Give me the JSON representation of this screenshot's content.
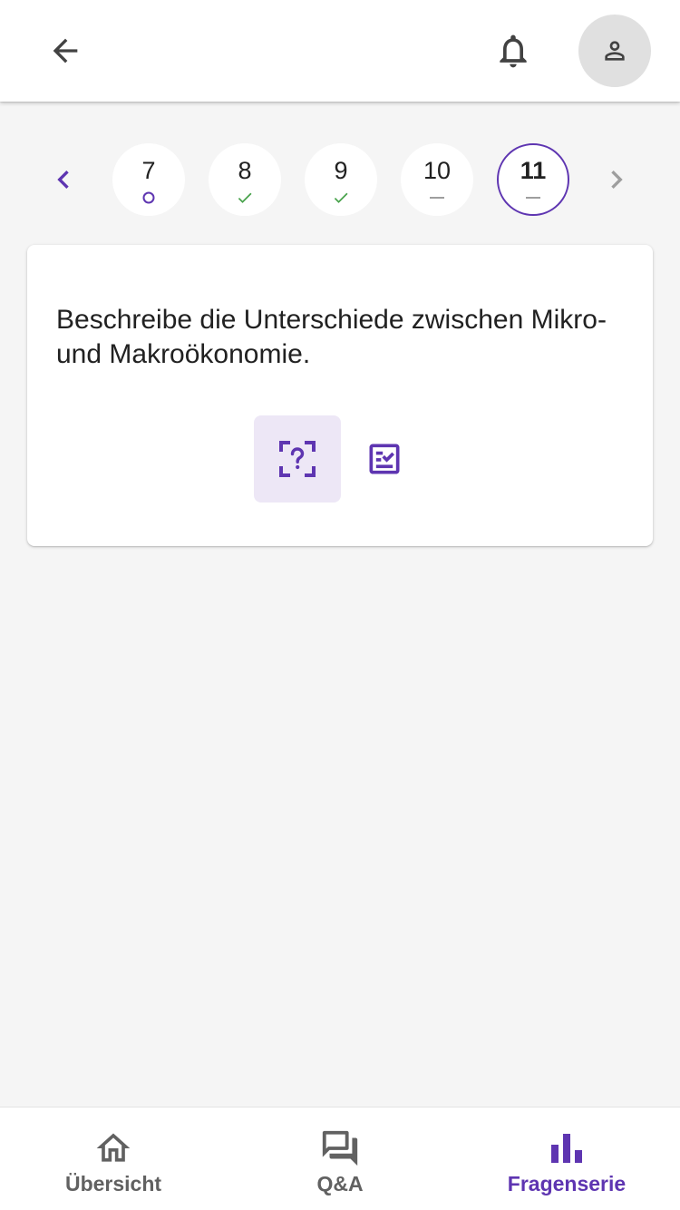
{
  "header": {
    "back_icon": "arrow-left-icon",
    "notification_icon": "bell-icon",
    "profile_icon": "person-icon"
  },
  "question_nav": {
    "prev_icon": "chevron-left-icon",
    "next_icon": "chevron-right-icon",
    "items": [
      {
        "number": "7",
        "status": "open",
        "status_icon": "circle-outline-icon"
      },
      {
        "number": "8",
        "status": "correct",
        "status_icon": "check-icon"
      },
      {
        "number": "9",
        "status": "correct",
        "status_icon": "check-icon"
      },
      {
        "number": "10",
        "status": "skipped",
        "status_icon": "dash-icon"
      },
      {
        "number": "11",
        "status": "skipped",
        "status_icon": "dash-icon",
        "active": true
      }
    ]
  },
  "card": {
    "question": "Beschreibe die Unterschiede zwischen Mi­kro- und Makroökonomie.",
    "modes": [
      {
        "icon": "question-frame-icon",
        "selected": true
      },
      {
        "icon": "checklist-icon",
        "selected": false
      }
    ]
  },
  "bottom_nav": {
    "items": [
      {
        "label": "Übersicht",
        "icon": "home-icon",
        "active": false
      },
      {
        "label": "Q&A",
        "icon": "forum-icon",
        "active": false
      },
      {
        "label": "Fragenserie",
        "icon": "bar-chart-icon",
        "active": true
      }
    ]
  },
  "colors": {
    "accent": "#5e35b1",
    "accent_light": "#ede7f6",
    "success": "#43a047",
    "neutral": "#9e9e9e",
    "background": "#f5f5f5"
  }
}
